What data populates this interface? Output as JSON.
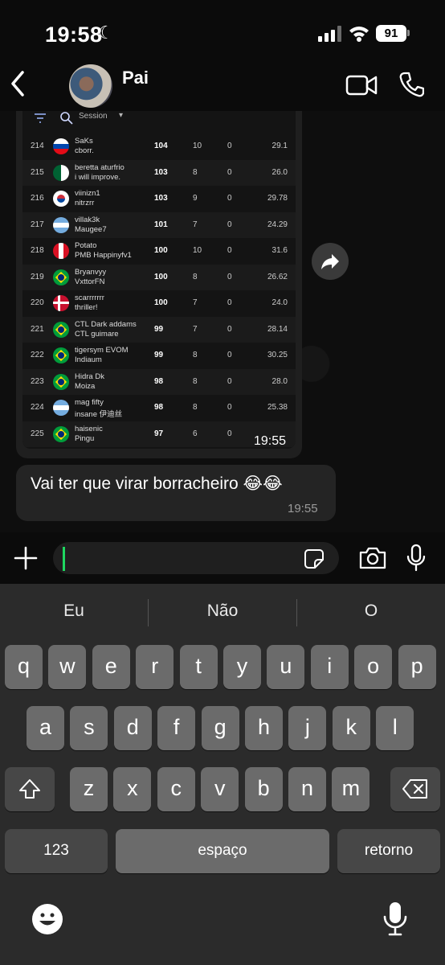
{
  "status_bar": {
    "time": "19:58",
    "battery": "91"
  },
  "header": {
    "chat_name": "Pai"
  },
  "screenshot": {
    "session_label": "Session",
    "rows": [
      {
        "rank": "214",
        "name1": "SaKs",
        "name2": "cborr.",
        "score": "104",
        "c1": "10",
        "c2": "0",
        "c3": "29.1",
        "flag": "slovenia"
      },
      {
        "rank": "215",
        "name1": "beretta aturfrio",
        "name2": "i will improve.",
        "score": "103",
        "c1": "8",
        "c2": "0",
        "c3": "26.0",
        "flag": "algeria"
      },
      {
        "rank": "216",
        "name1": "viinizn1",
        "name2": "nitrzrr",
        "score": "103",
        "c1": "9",
        "c2": "0",
        "c3": "29.78",
        "flag": "korea"
      },
      {
        "rank": "217",
        "name1": "villak3k",
        "name2": "Maugee7",
        "score": "101",
        "c1": "7",
        "c2": "0",
        "c3": "24.29",
        "flag": "argentina"
      },
      {
        "rank": "218",
        "name1": "Potato",
        "name2": "PMB Happinyfv1",
        "score": "100",
        "c1": "10",
        "c2": "0",
        "c3": "31.6",
        "flag": "peru"
      },
      {
        "rank": "219",
        "name1": "Bryanvyy",
        "name2": "VxttorFN",
        "score": "100",
        "c1": "8",
        "c2": "0",
        "c3": "26.62",
        "flag": "brazil"
      },
      {
        "rank": "220",
        "name1": "scarrrrrrr",
        "name2": "thriller!",
        "score": "100",
        "c1": "7",
        "c2": "0",
        "c3": "24.0",
        "flag": "denmark"
      },
      {
        "rank": "221",
        "name1": "CTL Dark addams",
        "name2": "CTL guimare",
        "score": "99",
        "c1": "7",
        "c2": "0",
        "c3": "28.14",
        "flag": "brazil"
      },
      {
        "rank": "222",
        "name1": "tigersym EVOM",
        "name2": "Indiaum",
        "score": "99",
        "c1": "8",
        "c2": "0",
        "c3": "30.25",
        "flag": "brazil"
      },
      {
        "rank": "223",
        "name1": "Hidra Dk",
        "name2": "Moiza",
        "score": "98",
        "c1": "8",
        "c2": "0",
        "c3": "28.0",
        "flag": "brazil"
      },
      {
        "rank": "224",
        "name1": "mag fifty",
        "name2": "insane 伊迪丝",
        "score": "98",
        "c1": "8",
        "c2": "0",
        "c3": "25.38",
        "flag": "argentina"
      },
      {
        "rank": "225",
        "name1": "haisenic",
        "name2": "Pingu",
        "score": "97",
        "c1": "6",
        "c2": "0",
        "c3": "",
        "flag": "brazil"
      }
    ],
    "time": "19:55"
  },
  "message": {
    "text": "Vai ter que virar borracheiro 😂😂",
    "time": "19:55"
  },
  "suggestions": [
    "Eu",
    "Não",
    "O"
  ],
  "keyboard": {
    "row1": [
      "q",
      "w",
      "e",
      "r",
      "t",
      "y",
      "u",
      "i",
      "o",
      "p"
    ],
    "row2": [
      "a",
      "s",
      "d",
      "f",
      "g",
      "h",
      "j",
      "k",
      "l"
    ],
    "row3": [
      "z",
      "x",
      "c",
      "v",
      "b",
      "n",
      "m"
    ],
    "numbers": "123",
    "space": "espaço",
    "return": "retorno"
  },
  "colors": {
    "accent": "#1ed760",
    "bubble": "#242424",
    "background": "#0b0b0b"
  }
}
